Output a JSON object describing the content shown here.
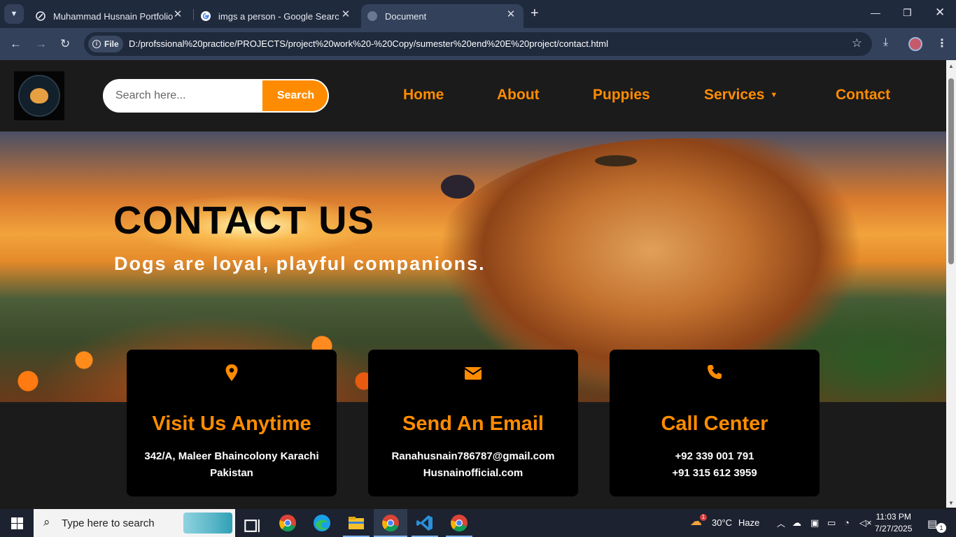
{
  "browser": {
    "tabs": [
      {
        "title": "Muhammad Husnain Portfolio D"
      },
      {
        "title": "imgs a person - Google Search"
      },
      {
        "title": "Document"
      }
    ],
    "address": {
      "chip": "File",
      "url": "D:/profssional%20practice/PROJECTS/project%20work%20-%20Copy/sumester%20end%20E%20project/contact.html"
    }
  },
  "site": {
    "search": {
      "placeholder": "Search here...",
      "button": "Search"
    },
    "nav": [
      "Home",
      "About",
      "Puppies",
      "Services",
      "Contact"
    ],
    "hero": {
      "title": "CONTACT US",
      "subtitle": "Dogs are loyal, playful companions."
    },
    "cards": [
      {
        "icon": "map-pin-icon",
        "title": "Visit Us Anytime",
        "line1": "342/A, Maleer Bhaincolony Karachi",
        "line2": "Pakistan"
      },
      {
        "icon": "envelope-icon",
        "title": "Send An Email",
        "line1": "Ranahusnain786787@gmail.com",
        "line2": "Husnainofficial.com"
      },
      {
        "icon": "phone-icon",
        "title": "Call Center",
        "line1": "+92 339 001 791",
        "line2": "+91 315 612 3959"
      }
    ]
  },
  "taskbar": {
    "search_placeholder": "Type here to search",
    "weather": {
      "temp": "30°C",
      "condition": "Haze",
      "badge": "1"
    },
    "time": "11:03 PM",
    "date": "7/27/2025",
    "notifications": "1"
  },
  "colors": {
    "accent": "#ff8c00",
    "card_bg": "#000000",
    "page_bg": "#1b1b1b"
  }
}
